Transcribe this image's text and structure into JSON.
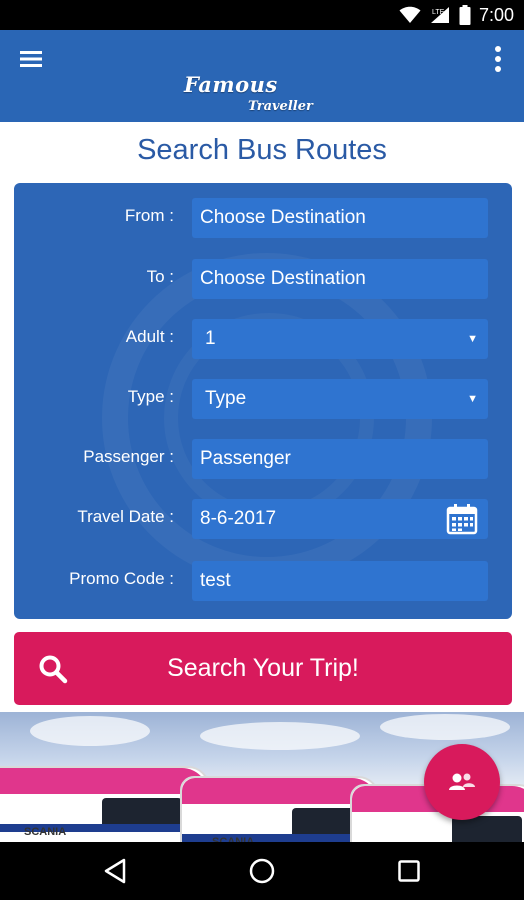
{
  "status_bar": {
    "time": "7:00",
    "icons": [
      "wifi-icon",
      "signal-icon",
      "battery-icon"
    ]
  },
  "app_bar": {
    "brand_line1": "Famous",
    "brand_line2": "Traveller",
    "menu_icon": "hamburger-menu-icon",
    "more_icon": "more-vert-icon",
    "color": "#2a66b5"
  },
  "page": {
    "title": "Search Bus Routes"
  },
  "form": {
    "from_label": "From :",
    "from_value": "Choose Destination",
    "to_label": "To :",
    "to_value": "Choose Destination",
    "adult_label": "Adult :",
    "adult_value": "1",
    "type_label": "Type :",
    "type_value": "Type",
    "passenger_label": "Passenger :",
    "passenger_value": "Passenger",
    "travel_date_label": "Travel Date :",
    "travel_date_value": "8-6-2017",
    "promo_label": "Promo Code :",
    "promo_value": "test",
    "card_color": "#2d66b6",
    "field_color": "#2f74d0"
  },
  "search_button": {
    "label": "Search Your Trip!",
    "icon": "search-icon",
    "color": "#d81a5c"
  },
  "banner": {
    "bus_brand": "SCANIA"
  },
  "fab": {
    "icon": "group-chat-icon",
    "color": "#d81a5c"
  },
  "nav_bar": {
    "icons": [
      "back-icon",
      "home-icon",
      "recents-icon"
    ]
  }
}
